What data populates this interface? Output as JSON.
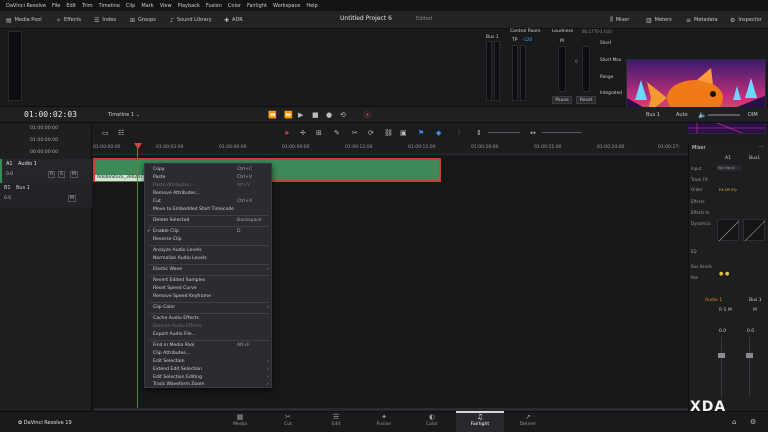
{
  "menu": [
    "DaVinci Resolve",
    "File",
    "Edit",
    "Trim",
    "Timeline",
    "Clip",
    "Mark",
    "View",
    "Playback",
    "Fusion",
    "Color",
    "Fairlight",
    "Workspace",
    "Help"
  ],
  "toolbar": {
    "media_pool": "Media Pool",
    "effects": "Effects",
    "index": "Index",
    "groups": "Groups",
    "sound_library": "Sound Library",
    "adr": "ADR",
    "project_title": "Untitled Project 6",
    "edited": "Edited",
    "mixer": "Mixer",
    "meters": "Meters",
    "metadata": "Metadata",
    "inspector": "Inspector"
  },
  "upper": {
    "bus1": "Bus 1",
    "control_room": "Control Room",
    "tp": "TP",
    "tp_value": "-120",
    "m": "M",
    "loudness": "Loudness",
    "loudness_std": "BS.1770-1 (LU)",
    "short": "Short",
    "short_max": "Short Max",
    "range": "Range",
    "integrated": "Integrated",
    "scale_zero": "0",
    "pause": "Pause",
    "reset": "Reset"
  },
  "transport": {
    "timecode": "01:00:02:03",
    "timeline_name": "Timeline 1",
    "bus_label": "Bus 1",
    "auto": "Auto",
    "dim": "DIM"
  },
  "left_panel": {
    "tc_rows": [
      "01:00:00:00",
      "01:00:00:00",
      "00:00:00:00"
    ],
    "track_a1_id": "A1",
    "track_a1_name": "Audio 1",
    "track_a1_vol": "0.0",
    "track_b1_id": "B1",
    "track_b1_name": "Bus 1",
    "track_b1_vol": "0.0"
  },
  "ruler_ticks": [
    "01:00:00:00",
    "01:00:03:00",
    "01:00:06:00",
    "01:00:09:00",
    "01:00:12:00",
    "01:00:15:00",
    "01:00:18:00",
    "01:00:21:00",
    "01:00:24:00",
    "01:00:27:"
  ],
  "clip": {
    "name": "AdobeStock_390247157"
  },
  "context_menu": [
    {
      "label": "Copy",
      "shortcut": "Ctrl+C",
      "disabled": false
    },
    {
      "label": "Paste",
      "shortcut": "Ctrl+V",
      "disabled": false
    },
    {
      "label": "Paste Attributes...",
      "shortcut": "Alt+V",
      "disabled": true
    },
    {
      "label": "Remove Attributes...",
      "shortcut": "",
      "disabled": false
    },
    {
      "label": "Cut",
      "shortcut": "Ctrl+X",
      "disabled": false
    },
    {
      "label": "Move to Embedded Start Timecode",
      "shortcut": "",
      "disabled": false
    },
    {
      "label": "Delete Selected",
      "shortcut": "Backspace",
      "disabled": false
    },
    {
      "label": "Enable Clip",
      "shortcut": "D",
      "disabled": false,
      "checked": true
    },
    {
      "label": "Reverse Clip",
      "shortcut": "",
      "disabled": false
    },
    {
      "label": "Analyze Audio Levels",
      "shortcut": "",
      "disabled": false
    },
    {
      "label": "Normalize Audio Levels",
      "shortcut": "",
      "disabled": false
    },
    {
      "label": "Elastic Wave",
      "shortcut": "",
      "disabled": false,
      "submenu": true
    },
    {
      "label": "Revert Edited Samples",
      "shortcut": "",
      "disabled": false
    },
    {
      "label": "Reset Speed Curve",
      "shortcut": "",
      "disabled": false
    },
    {
      "label": "Remove Speed Keyframe",
      "shortcut": "",
      "disabled": false
    },
    {
      "label": "Clip Color",
      "shortcut": "",
      "disabled": false,
      "submenu": true
    },
    {
      "label": "Cache Audio Effects",
      "shortcut": "",
      "disabled": false
    },
    {
      "label": "Bounce Audio Effects",
      "shortcut": "",
      "disabled": true
    },
    {
      "label": "Export Audio File...",
      "shortcut": "",
      "disabled": false
    },
    {
      "label": "Find in Media Pool",
      "shortcut": "Alt+F",
      "disabled": false
    },
    {
      "label": "Clip Attributes...",
      "shortcut": "",
      "disabled": false
    },
    {
      "label": "Edit Selection",
      "shortcut": "",
      "disabled": false,
      "submenu": true
    },
    {
      "label": "Extend Edit Selection",
      "shortcut": "",
      "disabled": false,
      "submenu": true
    },
    {
      "label": "Edit Selection Editing",
      "shortcut": "",
      "disabled": false,
      "submenu": true
    },
    {
      "label": "Track Waveform Zoom",
      "shortcut": "",
      "disabled": false,
      "submenu": true
    }
  ],
  "mixer": {
    "title": "Mixer",
    "col_a1": "A1",
    "col_bus1": "Bus1",
    "input": "Input",
    "input_value": "No Input",
    "track_fx": "Track FX",
    "order": "Order",
    "order_value": "FX DY EQ",
    "effects": "Effects",
    "effects_in": "Effects In",
    "dynamics": "Dynamics",
    "eq": "EQ",
    "bus_sends": "Bus Sends",
    "pan": "Pan",
    "strip_a1": "Audio 1",
    "strip_bus1": "Bus 1",
    "fader_a1": "0.0",
    "fader_bus1": "0.0"
  },
  "pages": [
    {
      "label": "Media",
      "icon": "▦"
    },
    {
      "label": "Cut",
      "icon": "✂"
    },
    {
      "label": "Edit",
      "icon": "☰"
    },
    {
      "label": "Fusion",
      "icon": "✦"
    },
    {
      "label": "Color",
      "icon": "◐"
    },
    {
      "label": "Fairlight",
      "icon": "♫"
    },
    {
      "label": "Deliver",
      "icon": "➚"
    }
  ],
  "brand": "DaVinci Resolve 19",
  "watermark": "XDA",
  "colors": {
    "clip": "#3d8a58",
    "selection": "#d23a3a",
    "playhead": "#e04040",
    "accent_orange": "#e08a20"
  }
}
